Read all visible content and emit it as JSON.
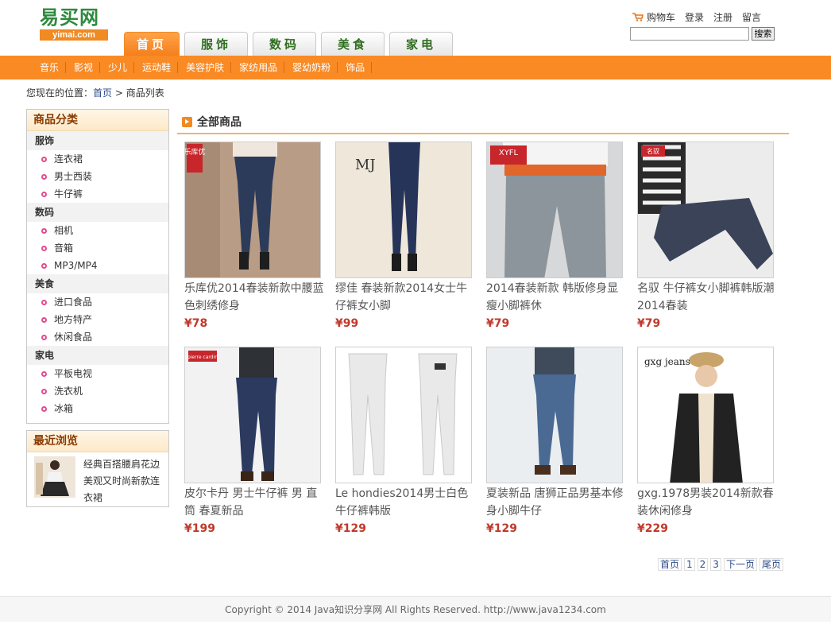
{
  "logo": {
    "cn": "易买网",
    "en": "yimai.com"
  },
  "top_links": {
    "cart": "购物车",
    "login": "登录",
    "register": "注册",
    "message": "留言"
  },
  "search": {
    "placeholder": "",
    "button": "搜索"
  },
  "tabs": [
    {
      "label": "首页",
      "active": true
    },
    {
      "label": "服饰"
    },
    {
      "label": "数码"
    },
    {
      "label": "美食"
    },
    {
      "label": "家电"
    }
  ],
  "categories": [
    "音乐",
    "影视",
    "少儿",
    "运动鞋",
    "美容护肤",
    "家纺用品",
    "婴幼奶粉",
    "饰品"
  ],
  "breadcrumb": {
    "prefix": "您现在的位置：",
    "home": "首页",
    "sep": " > ",
    "current": "商品列表"
  },
  "sidebar": {
    "title": "商品分类",
    "groups": [
      {
        "name": "服饰",
        "items": [
          "连衣裙",
          "男士西装",
          "牛仔裤"
        ]
      },
      {
        "name": "数码",
        "items": [
          "相机",
          "音箱",
          "MP3/MP4"
        ]
      },
      {
        "name": "美食",
        "items": [
          "进口食品",
          "地方特产",
          "休闲食品"
        ]
      },
      {
        "name": "家电",
        "items": [
          "平板电视",
          "洗衣机",
          "冰箱"
        ]
      }
    ]
  },
  "recent": {
    "title": "最近浏览",
    "item": "经典百搭腰肩花边美观又时尚新款连衣裙"
  },
  "main": {
    "title": "全部商品"
  },
  "products": [
    {
      "name": "乐库优2014春装新款中腰蓝色刺绣修身",
      "price": "¥78",
      "brand": "乐库优",
      "color": "#2c3b5a"
    },
    {
      "name": "缪佳 春装新款2014女士牛仔裤女小脚",
      "price": "¥99",
      "brand": "MJ",
      "color": "#27345a"
    },
    {
      "name": "2014春装新款 韩版修身显瘦小脚裤休",
      "price": "¥79",
      "brand": "XYFL",
      "color": "#8c959b"
    },
    {
      "name": "名驭 牛仔裤女小脚裤韩版潮2014春装",
      "price": "¥79",
      "brand": "名驭",
      "color": "#3a4357"
    },
    {
      "name": "皮尔卡丹 男士牛仔裤 男 直筒 春夏新品",
      "price": "¥199",
      "brand": "pierre cardin",
      "color": "#2b3a5e"
    },
    {
      "name": "Le hondies2014男士白色牛仔裤韩版",
      "price": "¥129",
      "brand": "",
      "color": "#e9e9e9"
    },
    {
      "name": "夏装新品 唐狮正品男基本修身小脚牛仔",
      "price": "¥129",
      "brand": "",
      "color": "#4a6a94"
    },
    {
      "name": "gxg.1978男装2014新款春装休闲修身",
      "price": "¥229",
      "brand": "gxg jeans",
      "color": "#222222"
    }
  ],
  "pager": [
    "首页",
    "1",
    "2",
    "3",
    "下一页",
    "尾页"
  ],
  "footer": "Copyright © 2014 Java知识分享网 All Rights Reserved. http://www.java1234.com"
}
